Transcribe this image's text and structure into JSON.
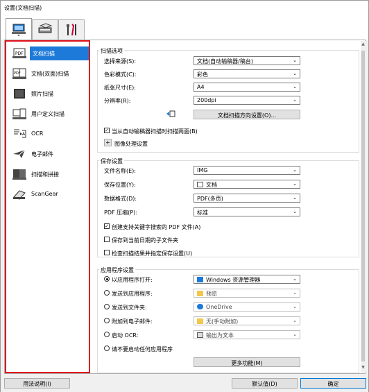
{
  "window": {
    "title": "设置(文档扫描)"
  },
  "tabs": [
    {
      "name": "scan-tab",
      "icon": "computer-scan-icon"
    },
    {
      "name": "scanner-tab",
      "icon": "scanner-icon"
    },
    {
      "name": "tools-tab",
      "icon": "tools-icon"
    }
  ],
  "sidebar": {
    "items": [
      {
        "label": "文档扫描",
        "icon": "document-scan-icon"
      },
      {
        "label": "文档(双面)扫描",
        "icon": "duplex-scan-icon"
      },
      {
        "label": "照片扫描",
        "icon": "photo-scan-icon"
      },
      {
        "label": "用户定义扫描",
        "icon": "custom-scan-icon"
      },
      {
        "label": "OCR",
        "icon": "ocr-icon"
      },
      {
        "label": "电子邮件",
        "icon": "email-icon"
      },
      {
        "label": "扫描和拼接",
        "icon": "stitch-icon"
      },
      {
        "label": "ScanGear",
        "icon": "scangear-icon"
      }
    ]
  },
  "scan_options": {
    "title": "扫描选项",
    "source_label": "选择来源(S):",
    "source": "文档(自动输稿器/稿台)",
    "color_label": "色彩模式(C):",
    "color": "彩色",
    "size_label": "纸张尺寸(E):",
    "size": "A4",
    "res_label": "分辨率(R):",
    "res": "200dpi",
    "orient_btn": "文档扫描方向设置(O)...",
    "both_sides": "当从自动输稿器扫描时扫描两面(B)",
    "image_proc": "图像处理设置"
  },
  "save_settings": {
    "title": "保存设置",
    "name_label": "文件名称(E):",
    "name": "IMG",
    "loc_label": "保存位置(Y):",
    "loc": "文档",
    "fmt_label": "数据格式(D):",
    "fmt": "PDF(多页)",
    "comp_label": "PDF 压缩(P):",
    "comp": "标准",
    "keyword": "创建支持关键字搜索的 PDF 文件(A)",
    "subfolder": "保存到当前日期的子文件夹",
    "check": "检查扫描结果并指定保存设置(U)"
  },
  "app_settings": {
    "title": "应用程序设置",
    "open_label": "以应用程序打开:",
    "open": "Windows 资源管理器",
    "send_label": "发送到应用程序:",
    "send": "预览",
    "folder_label": "发送到文件夹:",
    "folder": "OneDrive",
    "email_label": "附加到电子邮件:",
    "email": "无(手动附加)",
    "ocr_label": "启动 OCR:",
    "ocr": "输出为文本",
    "none_label": "请不要启动任何应用程序",
    "more_btn": "更多功能(M)"
  },
  "footer": {
    "help": "用法说明(I)",
    "defaults": "默认值(D)",
    "ok": "确定"
  }
}
